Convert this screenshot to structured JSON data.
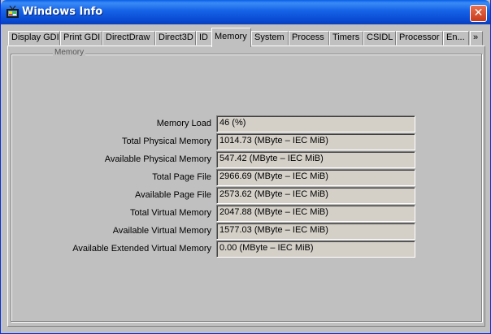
{
  "window": {
    "title": "Windows Info",
    "close_glyph": "✕"
  },
  "tabs": [
    {
      "label": "Display GDI"
    },
    {
      "label": "Print GDI"
    },
    {
      "label": "DirectDraw"
    },
    {
      "label": "Direct3D"
    },
    {
      "label": "ID"
    },
    {
      "label": "Memory",
      "active": true
    },
    {
      "label": "System"
    },
    {
      "label": "Process"
    },
    {
      "label": "Timers"
    },
    {
      "label": "CSIDL"
    },
    {
      "label": "Processor"
    },
    {
      "label": "En..."
    },
    {
      "label": "»"
    }
  ],
  "group": {
    "title": "Memory"
  },
  "rows": [
    {
      "label": "Memory Load",
      "value": "46 (%)"
    },
    {
      "label": "Total Physical Memory",
      "value": "1014.73 (MByte – IEC MiB)"
    },
    {
      "label": "Available Physical Memory",
      "value": "547.42 (MByte – IEC MiB)"
    },
    {
      "label": "Total Page File",
      "value": "2966.69 (MByte – IEC MiB)"
    },
    {
      "label": "Available Page File",
      "value": "2573.62 (MByte – IEC MiB)"
    },
    {
      "label": "Total Virtual Memory",
      "value": "2047.88 (MByte – IEC MiB)"
    },
    {
      "label": "Available Virtual Memory",
      "value": "1577.03 (MByte – IEC MiB)"
    },
    {
      "label": "Available Extended Virtual Memory",
      "value": "0.00 (MByte – IEC MiB)"
    }
  ],
  "colors": {
    "titlebar": "#0a5fe8",
    "close_button": "#d8492a",
    "face": "#c0c0c0"
  },
  "icons": {
    "app": "windows-info-app-icon",
    "close": "close-icon"
  }
}
